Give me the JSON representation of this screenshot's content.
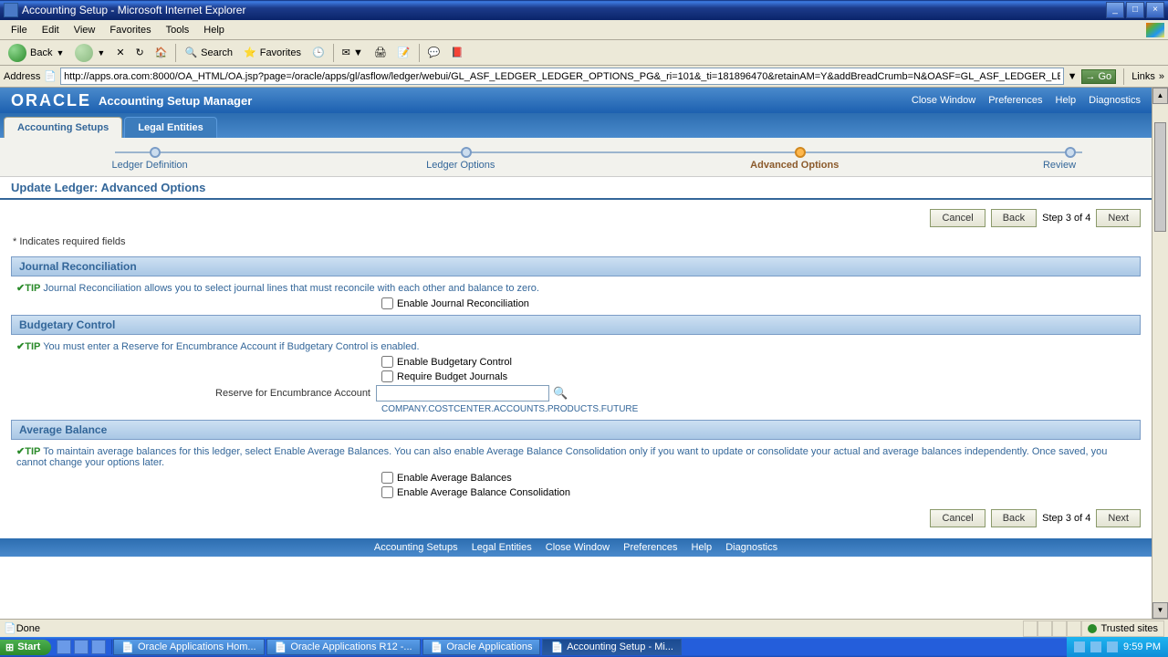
{
  "window": {
    "title": "Accounting Setup - Microsoft Internet Explorer"
  },
  "menus": {
    "file": "File",
    "edit": "Edit",
    "view": "View",
    "favorites": "Favorites",
    "tools": "Tools",
    "help": "Help"
  },
  "toolbar": {
    "back": "Back",
    "search": "Search",
    "favorites": "Favorites"
  },
  "address": {
    "label": "Address",
    "url": "http://apps.ora.com:8000/OA_HTML/OA.jsp?page=/oracle/apps/gl/asflow/ledger/webui/GL_ASF_LEDGER_LEDGER_OPTIONS_PG&_ri=101&_ti=181896470&retainAM=Y&addBreadCrumb=N&OASF=GL_ASF_LEDGER_LEDGER_OPTIONS&oapc=",
    "go": "Go",
    "links": "Links"
  },
  "header": {
    "logo": "ORACLE",
    "app": "Accounting Setup Manager",
    "links": {
      "close": "Close Window",
      "prefs": "Preferences",
      "help": "Help",
      "diag": "Diagnostics"
    }
  },
  "tabs": {
    "as": "Accounting Setups",
    "le": "Legal Entities"
  },
  "train": {
    "s1": "Ledger Definition",
    "s2": "Ledger Options",
    "s3": "Advanced Options",
    "s4": "Review"
  },
  "page": {
    "title": "Update Ledger: Advanced Options",
    "req": "* Indicates required fields",
    "step": "Step 3 of 4"
  },
  "buttons": {
    "cancel": "Cancel",
    "back": "Back",
    "next": "Next"
  },
  "journal": {
    "hdr": "Journal Reconciliation",
    "tip": "Journal Reconciliation allows you to select journal lines that must reconcile with each other and balance to zero.",
    "chk1": "Enable Journal Reconciliation"
  },
  "budget": {
    "hdr": "Budgetary Control",
    "tip": "You must enter a Reserve for Encumbrance Account if Budgetary Control is enabled.",
    "chk1": "Enable Budgetary Control",
    "chk2": "Require Budget Journals",
    "field": "Reserve for Encumbrance Account",
    "hint": "COMPANY.COSTCENTER.ACCOUNTS.PRODUCTS.FUTURE"
  },
  "avg": {
    "hdr": "Average Balance",
    "tip": "To maintain average balances for this ledger, select Enable Average Balances. You can also enable Average Balance Consolidation only if you want to update or consolidate your actual and average balances independently. Once saved, you cannot change your options later.",
    "chk1": "Enable Average Balances",
    "chk2": "Enable Average Balance Consolidation"
  },
  "tip_label": "TIP",
  "footer": {
    "as": "Accounting Setups",
    "le": "Legal Entities",
    "cw": "Close Window",
    "pr": "Preferences",
    "hp": "Help",
    "dg": "Diagnostics"
  },
  "status": {
    "done": "Done",
    "trusted": "Trusted sites"
  },
  "taskbar": {
    "start": "Start",
    "t1": "Oracle Applications Hom...",
    "t2": "Oracle Applications R12 -...",
    "t3": "Oracle Applications",
    "t4": "Accounting Setup - Mi...",
    "time": "9:59 PM"
  }
}
